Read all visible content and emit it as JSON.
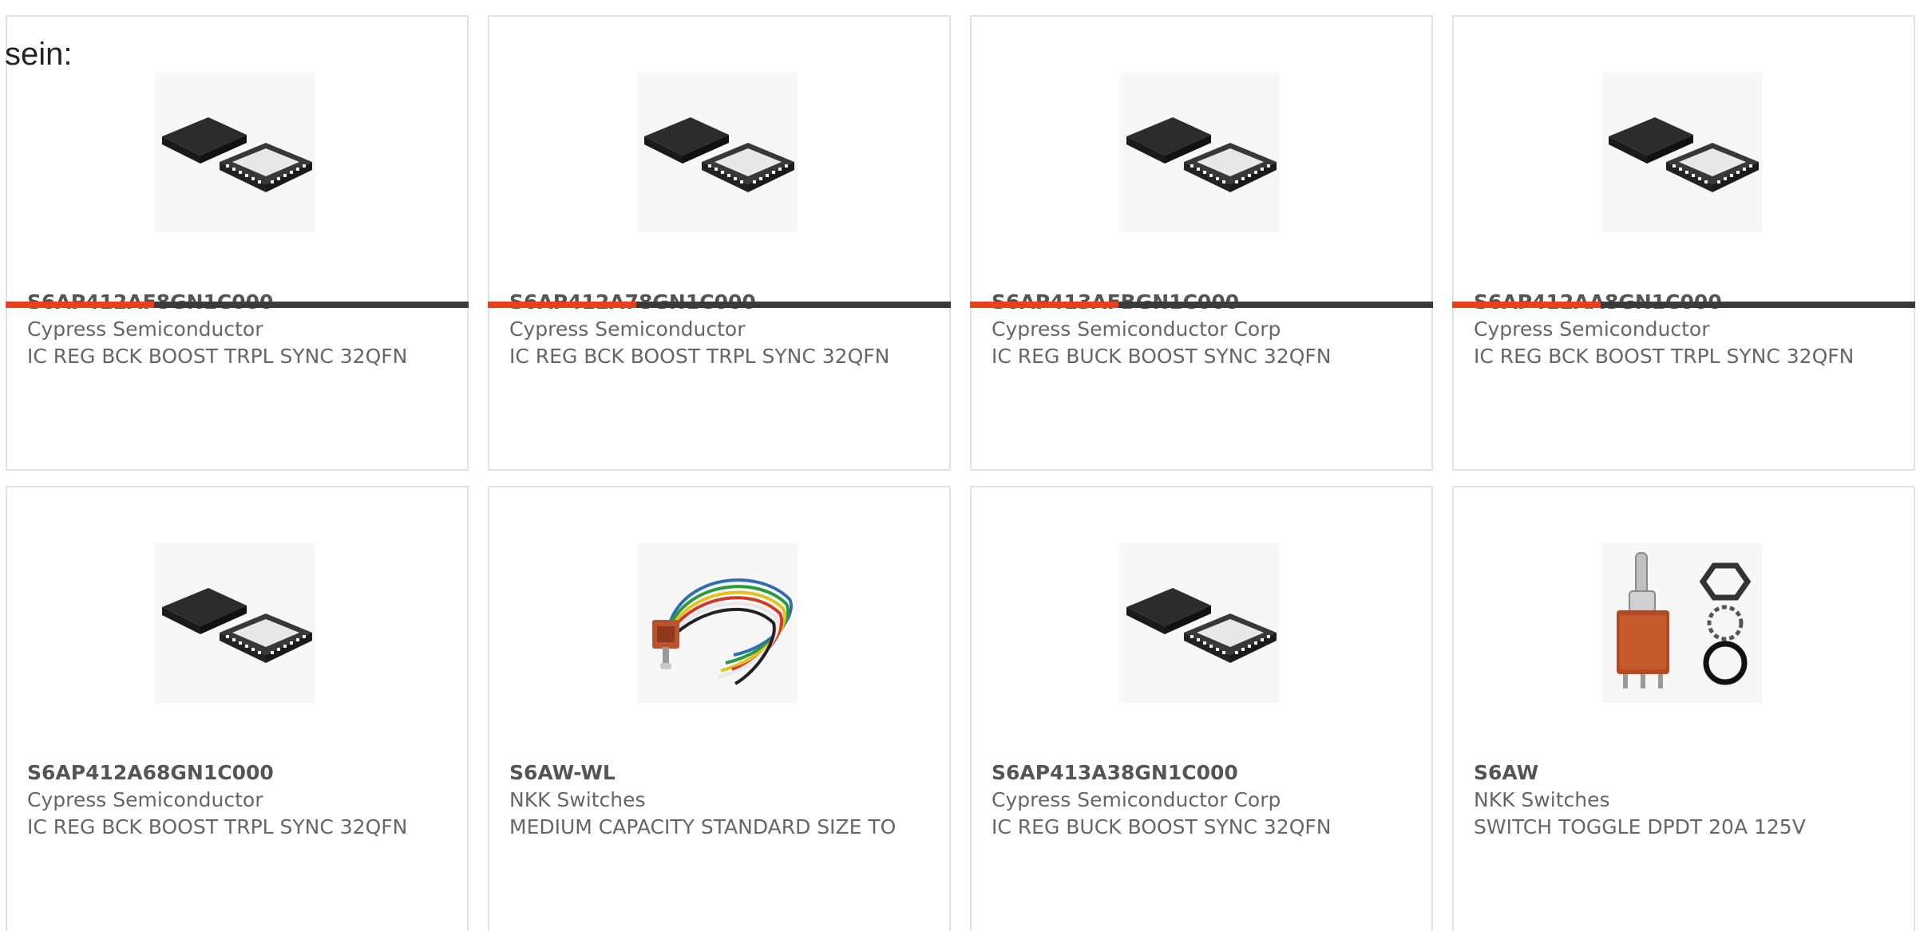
{
  "intro": {
    "text": "sein:"
  },
  "colors": {
    "accent": "#e8401a",
    "bar_dark": "#3a3a3a",
    "card_border": "#e2e2e2"
  },
  "products": [
    {
      "part_number": "S6AP412AF8GN1C000",
      "manufacturer": "Cypress Semiconductor",
      "description": "IC REG BCK BOOST TRPL SYNC 32QFN",
      "image": "qfn-chip-icon",
      "progress": 0.32
    },
    {
      "part_number": "S6AP412A78GN1C000",
      "manufacturer": "Cypress Semiconductor",
      "description": "IC REG BCK BOOST TRPL SYNC 32QFN",
      "image": "qfn-chip-icon",
      "progress": 0.32
    },
    {
      "part_number": "S6AP413AFBGN1C000",
      "manufacturer": "Cypress Semiconductor Corp",
      "description": "IC REG BUCK BOOST SYNC 32QFN",
      "image": "qfn-chip-icon",
      "progress": 0.32
    },
    {
      "part_number": "S6AP412AA8GN1C000",
      "manufacturer": "Cypress Semiconductor",
      "description": "IC REG BCK BOOST TRPL SYNC 32QFN",
      "image": "qfn-chip-icon",
      "progress": 0.32
    },
    {
      "part_number": "S6AP412A68GN1C000",
      "manufacturer": "Cypress Semiconductor",
      "description": "IC REG BCK BOOST TRPL SYNC 32QFN",
      "image": "qfn-chip-icon"
    },
    {
      "part_number": "S6AW-WL",
      "manufacturer": "NKK Switches",
      "description": "MEDIUM CAPACITY STANDARD SIZE TO",
      "image": "toggle-switch-wired-icon"
    },
    {
      "part_number": "S6AP413A38GN1C000",
      "manufacturer": "Cypress Semiconductor Corp",
      "description": "IC REG BUCK BOOST SYNC 32QFN",
      "image": "qfn-chip-icon"
    },
    {
      "part_number": "S6AW",
      "manufacturer": "NKK Switches",
      "description": "SWITCH TOGGLE DPDT 20A 125V",
      "image": "toggle-switch-icon"
    }
  ]
}
